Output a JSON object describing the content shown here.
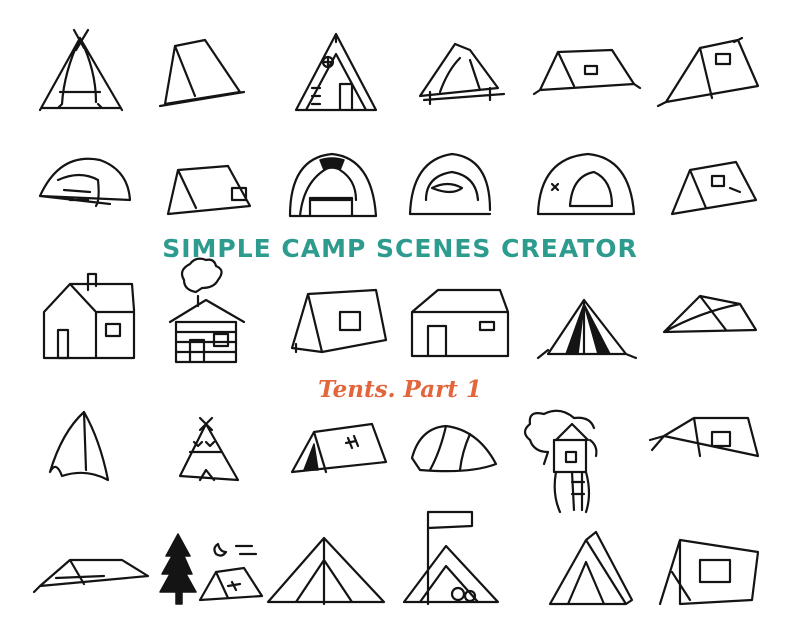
{
  "title": "SIMPLE CAMP SCENES CREATOR",
  "subtitle": "Tents. Part 1",
  "colors": {
    "title": "#2e9b8f",
    "subtitle": "#e2653c",
    "line": "#141414",
    "background": "#ffffff"
  },
  "icons": [
    "teepee-poles-icon",
    "pup-tent-icon",
    "a-frame-cabin-icon",
    "canopy-tent-icon",
    "patched-tent-icon",
    "ridge-tent-icon",
    "dome-tent-icon",
    "flap-tent-icon",
    "striped-dome-tent-icon",
    "tunnel-tent-icon",
    "dome-tent-with-door-icon",
    "patched-ridge-tent-icon",
    "house-icon",
    "log-cabin-icon",
    "cabin-tent-icon",
    "wall-tent-icon",
    "striped-tent-icon",
    "draped-tent-icon",
    "leaf-tent-icon",
    "teepee-icon",
    "pup-tent-window-icon",
    "tunnel-tent-icon",
    "treehouse-icon",
    "tarp-tent-icon",
    "lean-to-tent-icon",
    "forest-night-scene-icon",
    "bell-tent-icon",
    "flag-tent-icon",
    "a-frame-tent-icon",
    "poled-tarp-tent-icon"
  ]
}
